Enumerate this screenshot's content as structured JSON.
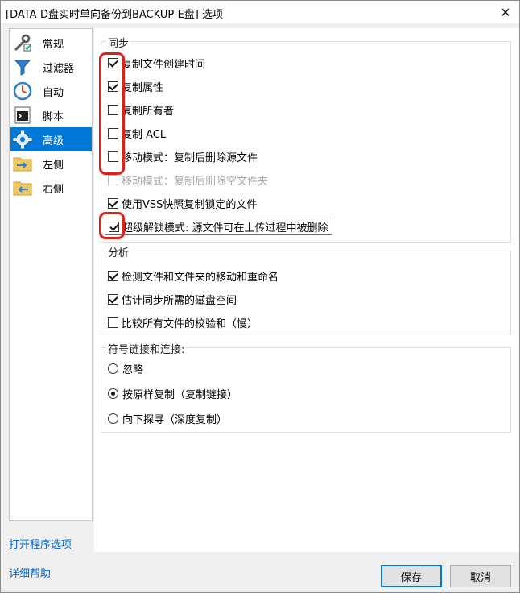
{
  "window": {
    "title": "[DATA-D盘实时单向备份到BACKUP-E盘] 选项",
    "close_label": "✕"
  },
  "sidebar": {
    "items": [
      {
        "label": "常规",
        "icon": "wrench-checklist-icon"
      },
      {
        "label": "过滤器",
        "icon": "funnel-icon"
      },
      {
        "label": "自动",
        "icon": "clock-icon"
      },
      {
        "label": "脚本",
        "icon": "terminal-icon"
      },
      {
        "label": "高级",
        "icon": "gear-icon",
        "active": true
      },
      {
        "label": "左侧",
        "icon": "folder-arrow-right-icon"
      },
      {
        "label": "右侧",
        "icon": "folder-arrow-left-icon"
      }
    ]
  },
  "sync": {
    "title": "同步",
    "options": [
      {
        "label": "复制文件创建时间",
        "checked": true
      },
      {
        "label": "复制属性",
        "checked": true
      },
      {
        "label": "复制所有者",
        "checked": false
      },
      {
        "label": "复制 ACL",
        "checked": false
      },
      {
        "label": "移动模式：复制后删除源文件",
        "checked": false
      },
      {
        "label": "移动模式：复制后删除空文件夹",
        "checked": false,
        "disabled": true
      },
      {
        "label": "使用VSS快照复制锁定的文件",
        "checked": true
      },
      {
        "label": "超级解锁模式: 源文件可在上传过程中被删除",
        "checked": true
      }
    ]
  },
  "analysis": {
    "title": "分析",
    "options": [
      {
        "label": "检测文件和文件夹的移动和重命名",
        "checked": true
      },
      {
        "label": "估计同步所需的磁盘空间",
        "checked": true
      },
      {
        "label": "比较所有文件的校验和（慢）",
        "checked": false
      }
    ]
  },
  "symlinks": {
    "title": "符号链接和连接:",
    "options": [
      {
        "label": "忽略",
        "selected": false
      },
      {
        "label": "按原样复制（复制链接）",
        "selected": true
      },
      {
        "label": "向下探寻（深度复制）",
        "selected": false
      }
    ]
  },
  "footer": {
    "open_program_options": "打开程序选项",
    "help": "详细帮助",
    "save": "保存",
    "cancel": "取消"
  },
  "colors": {
    "accent": "#0078d7",
    "annotation": "#e0201b",
    "link": "#0066cc"
  }
}
